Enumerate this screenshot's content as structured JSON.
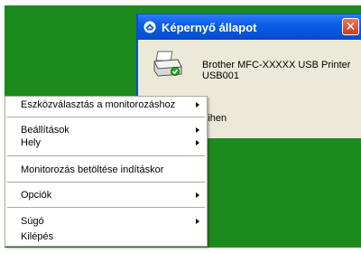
{
  "status_window": {
    "title": "Képernyő állapot",
    "close_glyph": "✕",
    "printer_name": "Brother MFC-XXXXX USB Printer",
    "port": "USB001",
    "status_text": "Pihen"
  },
  "context_menu": {
    "items": [
      {
        "label": "Eszközválasztás a monitorozáshoz",
        "submenu": true
      },
      {
        "label": "Beállítások",
        "submenu": true
      },
      {
        "label": "Hely",
        "submenu": true
      },
      {
        "label": "Monitorozás betöltése indításkor",
        "submenu": false
      },
      {
        "label": "Opciók",
        "submenu": true
      },
      {
        "label": "Súgó",
        "submenu": true
      },
      {
        "label": "Kilépés",
        "submenu": false
      }
    ]
  },
  "colors": {
    "desktop_background": "#1d8a1d",
    "titlebar": "#0b5de6",
    "window_body": "#ece9d8"
  },
  "icons": [
    "status-monitor-icon",
    "printer-icon",
    "close-icon",
    "chevron-right-icon"
  ]
}
